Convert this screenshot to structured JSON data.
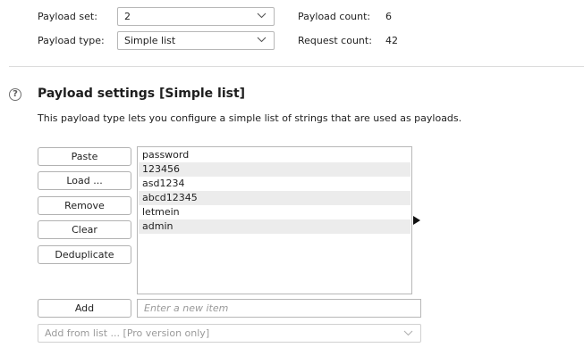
{
  "payload_config": {
    "set_label": "Payload set:",
    "set_value": "2",
    "type_label": "Payload type:",
    "type_value": "Simple list",
    "count_label": "Payload count:",
    "count_value": "6",
    "request_label": "Request count:",
    "request_value": "42"
  },
  "settings": {
    "title": "Payload settings [Simple list]",
    "description": "This payload type lets you configure a simple list of strings that are used as payloads.",
    "help_icon": "?"
  },
  "buttons": {
    "paste": "Paste",
    "load": "Load ...",
    "remove": "Remove",
    "clear": "Clear",
    "deduplicate": "Deduplicate",
    "add": "Add"
  },
  "payload_list": {
    "items": [
      "password",
      "123456",
      "asd1234",
      "abcd12345",
      "letmein",
      "admin"
    ]
  },
  "add_item": {
    "placeholder": "Enter a new item"
  },
  "add_from_list": {
    "value": "Add from list ... [Pro version only]"
  },
  "icons": {
    "help": "question-circle-icon",
    "dropdown": "chevron-down-icon",
    "list_arrow": "triangle-right-icon"
  }
}
